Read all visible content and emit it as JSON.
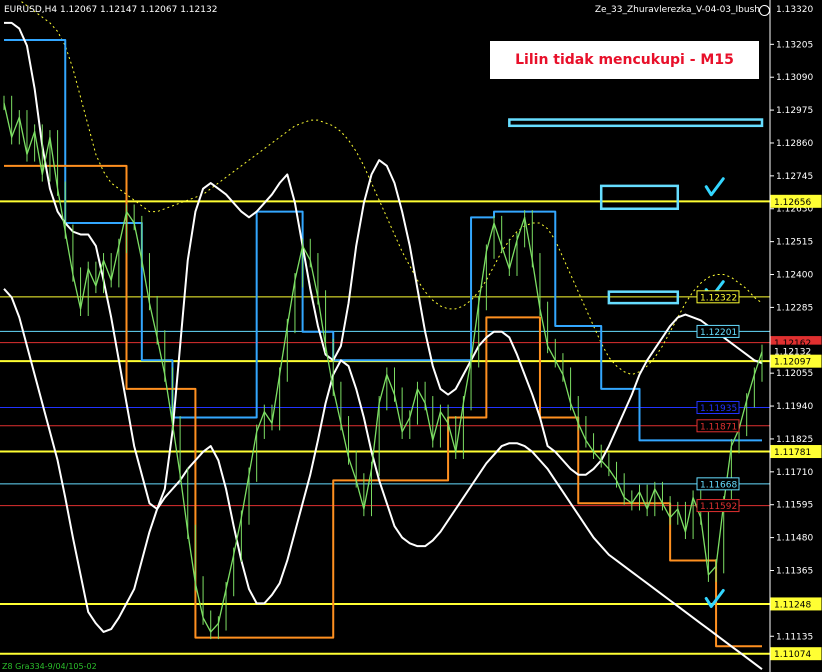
{
  "header": {
    "symbol_line": "EURUSD,H4  1.12067 1.12147 1.12067 1.12132",
    "indicator_name": "Ze_33_Zhuravlerezka_V-04-03_Ibush"
  },
  "annotation": {
    "text": "Lilin tidak mencukupi - M15"
  },
  "footer": {
    "text": "Z8 Gra334-9/04/105-02"
  },
  "colors": {
    "background": "#000000",
    "price": "#7ddf64",
    "envelope": "#ffffff",
    "step_upper": "#33a7ff",
    "step_lower": "#ff9020",
    "level_yellow": "#ffff33",
    "level_cyan": "#66ddff",
    "level_red": "#e03030",
    "level_blue": "#2233ff",
    "checkmark": "#33d6ff"
  },
  "chart_data": {
    "type": "line",
    "symbol": "EURUSD",
    "timeframe": "H4",
    "ohlc_header": {
      "open": 1.12067,
      "high": 1.12147,
      "low": 1.12067,
      "close": 1.12132
    },
    "ylim": [
      1.1101,
      1.1336
    ],
    "y_ticks": [
      "1.13320",
      "1.13205",
      "1.13090",
      "1.12975",
      "1.12860",
      "1.12745",
      "1.12630",
      "1.12515",
      "1.12400",
      "1.12285",
      "1.12170",
      "1.12055",
      "1.11940",
      "1.11825",
      "1.11710",
      "1.11595",
      "1.11480",
      "1.11365",
      "1.11250",
      "1.11135"
    ],
    "y_top_label": "1.13320",
    "price_tags": [
      {
        "text": "1.12656",
        "value": 1.12656,
        "bg": "#ffff33",
        "fg": "#000000"
      },
      {
        "text": "1.12322",
        "value": 1.12322,
        "bg": "#000000",
        "fg": "#ffff33",
        "border": "#ffff33"
      },
      {
        "text": "1.12201",
        "value": 1.12201,
        "bg": "#000000",
        "fg": "#66ddff",
        "border": "#66ddff"
      },
      {
        "text": "1.12162",
        "value": 1.12162,
        "bg": "#e03030",
        "fg": "#000000"
      },
      {
        "text": "1.12132",
        "value": 1.12132,
        "bg": "#000000",
        "fg": "#ffffff"
      },
      {
        "text": "1.12097",
        "value": 1.12097,
        "bg": "#ffff33",
        "fg": "#000000"
      },
      {
        "text": "1.11935",
        "value": 1.11935,
        "bg": "#000000",
        "fg": "#2233ff",
        "border": "#2233ff"
      },
      {
        "text": "1.11871",
        "value": 1.11871,
        "bg": "#000000",
        "fg": "#e03030",
        "border": "#e03030"
      },
      {
        "text": "1.11781",
        "value": 1.11781,
        "bg": "#ffff33",
        "fg": "#000000"
      },
      {
        "text": "1.11668",
        "value": 1.11668,
        "bg": "#000000",
        "fg": "#66ddff",
        "border": "#66ddff"
      },
      {
        "text": "1.11592",
        "value": 1.11592,
        "bg": "#000000",
        "fg": "#e03030",
        "border": "#e03030"
      },
      {
        "text": "1.11248",
        "value": 1.11248,
        "bg": "#ffff33",
        "fg": "#000000"
      },
      {
        "text": "1.11074",
        "value": 1.11074,
        "bg": "#ffff33",
        "fg": "#000000"
      }
    ],
    "levels": [
      {
        "value": 1.12656,
        "color": "#ffff33",
        "width": 2
      },
      {
        "value": 1.12322,
        "color": "#ffff33",
        "width": 1
      },
      {
        "value": 1.12201,
        "color": "#66ddff",
        "width": 1
      },
      {
        "value": 1.12162,
        "color": "#e03030",
        "width": 1
      },
      {
        "value": 1.12097,
        "color": "#ffff33",
        "width": 2
      },
      {
        "value": 1.11935,
        "color": "#2233ff",
        "width": 1
      },
      {
        "value": 1.11871,
        "color": "#e03030",
        "width": 1
      },
      {
        "value": 1.11781,
        "color": "#ffff33",
        "width": 2
      },
      {
        "value": 1.11668,
        "color": "#66ddff",
        "width": 1
      },
      {
        "value": 1.11592,
        "color": "#e03030",
        "width": 1
      },
      {
        "value": 1.11248,
        "color": "#ffff33",
        "width": 2
      },
      {
        "value": 1.11074,
        "color": "#ffff33",
        "width": 2
      }
    ],
    "x_count": 100,
    "series": [
      {
        "role": "price",
        "values": [
          1.13,
          1.1288,
          1.1295,
          1.1282,
          1.129,
          1.1275,
          1.1288,
          1.127,
          1.1255,
          1.124,
          1.1228,
          1.1242,
          1.1236,
          1.1245,
          1.1238,
          1.125,
          1.1262,
          1.1258,
          1.1245,
          1.123,
          1.1218,
          1.1205,
          1.1188,
          1.117,
          1.115,
          1.1132,
          1.112,
          1.1115,
          1.1118,
          1.113,
          1.1142,
          1.1155,
          1.117,
          1.1185,
          1.1192,
          1.1188,
          1.1205,
          1.1222,
          1.1238,
          1.125,
          1.1245,
          1.1232,
          1.1215,
          1.12,
          1.1188,
          1.1176,
          1.1168,
          1.1158,
          1.1172,
          1.1195,
          1.1205,
          1.1198,
          1.1185,
          1.119,
          1.12,
          1.1195,
          1.1182,
          1.1192,
          1.1188,
          1.1178,
          1.1195,
          1.121,
          1.123,
          1.1248,
          1.1258,
          1.125,
          1.1242,
          1.1252,
          1.126,
          1.1245,
          1.1228,
          1.1215,
          1.121,
          1.1205,
          1.1195,
          1.1188,
          1.1182,
          1.1178,
          1.1175,
          1.1172,
          1.1168,
          1.1162,
          1.116,
          1.1164,
          1.1158,
          1.1165,
          1.116,
          1.1155,
          1.1158,
          1.115,
          1.1162,
          1.1155,
          1.1135,
          1.1138,
          1.116,
          1.118,
          1.1186,
          1.1196,
          1.1205,
          1.1213
        ]
      },
      {
        "role": "envelope-upper",
        "values": [
          1.1328,
          1.1328,
          1.1326,
          1.132,
          1.1305,
          1.1285,
          1.127,
          1.1262,
          1.1258,
          1.1255,
          1.1254,
          1.1254,
          1.125,
          1.1238,
          1.1225,
          1.121,
          1.1195,
          1.118,
          1.117,
          1.116,
          1.1158,
          1.1165,
          1.1185,
          1.1215,
          1.1245,
          1.1262,
          1.127,
          1.1272,
          1.127,
          1.1268,
          1.1265,
          1.1262,
          1.126,
          1.1262,
          1.1265,
          1.1268,
          1.1272,
          1.1275,
          1.1265,
          1.125,
          1.1235,
          1.1222,
          1.1212,
          1.121,
          1.1215,
          1.123,
          1.125,
          1.1265,
          1.1275,
          1.128,
          1.1278,
          1.1272,
          1.1262,
          1.125,
          1.1235,
          1.122,
          1.1208,
          1.12,
          1.1198,
          1.12,
          1.1205,
          1.121,
          1.1215,
          1.1218,
          1.122,
          1.122,
          1.1218,
          1.1212,
          1.1205,
          1.1198,
          1.119,
          1.118,
          1.1178,
          1.1175,
          1.1172,
          1.117,
          1.117,
          1.1172,
          1.1175,
          1.118,
          1.1186,
          1.1192,
          1.1198,
          1.1205,
          1.121,
          1.1214,
          1.1218,
          1.1222,
          1.1225,
          1.1226,
          1.1225,
          1.1224,
          1.1222,
          1.122,
          1.1218,
          1.1216,
          1.1214,
          1.1212,
          1.121,
          1.1209
        ]
      },
      {
        "role": "envelope-lower",
        "values": [
          1.1235,
          1.1232,
          1.1225,
          1.1215,
          1.1205,
          1.1195,
          1.1185,
          1.1175,
          1.1162,
          1.1148,
          1.1135,
          1.1122,
          1.1118,
          1.1115,
          1.1116,
          1.112,
          1.1125,
          1.113,
          1.114,
          1.115,
          1.1158,
          1.1162,
          1.1165,
          1.1168,
          1.1172,
          1.1175,
          1.1178,
          1.118,
          1.1175,
          1.1165,
          1.1152,
          1.114,
          1.113,
          1.1125,
          1.1125,
          1.1128,
          1.1132,
          1.114,
          1.115,
          1.116,
          1.117,
          1.1182,
          1.1195,
          1.1205,
          1.121,
          1.1208,
          1.12,
          1.119,
          1.1178,
          1.1168,
          1.116,
          1.1152,
          1.1148,
          1.1146,
          1.1145,
          1.1145,
          1.1147,
          1.115,
          1.1154,
          1.1158,
          1.1162,
          1.1166,
          1.117,
          1.1174,
          1.1177,
          1.118,
          1.1181,
          1.1181,
          1.118,
          1.1178,
          1.1175,
          1.1172,
          1.1168,
          1.1164,
          1.116,
          1.1156,
          1.1152,
          1.1148,
          1.1145,
          1.1142,
          1.114,
          1.1138,
          1.1136,
          1.1134,
          1.1132,
          1.113,
          1.1128,
          1.1126,
          1.1124,
          1.1122,
          1.112,
          1.1118,
          1.1116,
          1.1114,
          1.1112,
          1.111,
          1.1108,
          1.1106,
          1.1104,
          1.1102
        ]
      },
      {
        "role": "step-upper",
        "values": [
          1.1322,
          1.1322,
          1.1322,
          1.1322,
          1.1322,
          1.1322,
          1.1322,
          1.1322,
          1.1258,
          1.1258,
          1.1258,
          1.1258,
          1.1258,
          1.1258,
          1.1258,
          1.1258,
          1.1258,
          1.1258,
          1.121,
          1.121,
          1.121,
          1.121,
          1.119,
          1.119,
          1.119,
          1.119,
          1.119,
          1.119,
          1.119,
          1.119,
          1.119,
          1.119,
          1.119,
          1.1262,
          1.1262,
          1.1262,
          1.1262,
          1.1262,
          1.1262,
          1.122,
          1.122,
          1.122,
          1.122,
          1.121,
          1.121,
          1.121,
          1.121,
          1.121,
          1.121,
          1.121,
          1.121,
          1.121,
          1.121,
          1.121,
          1.121,
          1.121,
          1.121,
          1.121,
          1.121,
          1.121,
          1.121,
          1.126,
          1.126,
          1.126,
          1.1262,
          1.1262,
          1.1262,
          1.1262,
          1.1262,
          1.1262,
          1.1262,
          1.1262,
          1.1222,
          1.1222,
          1.1222,
          1.1222,
          1.1222,
          1.1222,
          1.12,
          1.12,
          1.12,
          1.12,
          1.12,
          1.1182,
          1.1182,
          1.1182,
          1.1182,
          1.1182,
          1.1182,
          1.1182,
          1.1182,
          1.1182,
          1.1182,
          1.1182,
          1.1182,
          1.1182,
          1.1182,
          1.1182,
          1.1182,
          1.1182
        ]
      },
      {
        "role": "step-lower",
        "values": [
          1.1278,
          1.1278,
          1.1278,
          1.1278,
          1.1278,
          1.1278,
          1.1278,
          1.1278,
          1.1278,
          1.1278,
          1.1278,
          1.1278,
          1.1278,
          1.1278,
          1.1278,
          1.1278,
          1.12,
          1.12,
          1.12,
          1.12,
          1.12,
          1.12,
          1.12,
          1.12,
          1.12,
          1.1113,
          1.1113,
          1.1113,
          1.1113,
          1.1113,
          1.1113,
          1.1113,
          1.1113,
          1.1113,
          1.1113,
          1.1113,
          1.1113,
          1.1113,
          1.1113,
          1.1113,
          1.1113,
          1.1113,
          1.1113,
          1.1168,
          1.1168,
          1.1168,
          1.1168,
          1.1168,
          1.1168,
          1.1168,
          1.1168,
          1.1168,
          1.1168,
          1.1168,
          1.1168,
          1.1168,
          1.1168,
          1.1168,
          1.119,
          1.119,
          1.119,
          1.119,
          1.119,
          1.1225,
          1.1225,
          1.1225,
          1.1225,
          1.1225,
          1.1225,
          1.1225,
          1.119,
          1.119,
          1.119,
          1.119,
          1.119,
          1.116,
          1.116,
          1.116,
          1.116,
          1.116,
          1.116,
          1.116,
          1.116,
          1.116,
          1.116,
          1.116,
          1.116,
          1.114,
          1.114,
          1.114,
          1.114,
          1.114,
          1.114,
          1.111,
          1.111,
          1.111,
          1.111,
          1.111,
          1.111,
          1.111
        ]
      },
      {
        "role": "dotted-upper",
        "values": [
          1.1338,
          1.1338,
          1.1336,
          1.1334,
          1.1332,
          1.133,
          1.1328,
          1.1325,
          1.132,
          1.1312,
          1.1302,
          1.1292,
          1.1282,
          1.1276,
          1.1272,
          1.127,
          1.1268,
          1.1266,
          1.1264,
          1.1262,
          1.1262,
          1.1263,
          1.1264,
          1.1265,
          1.1266,
          1.1267,
          1.1268,
          1.127,
          1.1272,
          1.1274,
          1.1276,
          1.1278,
          1.128,
          1.1282,
          1.1284,
          1.1286,
          1.1288,
          1.129,
          1.1292,
          1.1293,
          1.1294,
          1.1294,
          1.1293,
          1.1292,
          1.129,
          1.1287,
          1.1283,
          1.1278,
          1.1272,
          1.1266,
          1.126,
          1.1254,
          1.1248,
          1.1243,
          1.1238,
          1.1234,
          1.1231,
          1.1229,
          1.1228,
          1.1228,
          1.1229,
          1.1231,
          1.1234,
          1.1238,
          1.1243,
          1.1248,
          1.1252,
          1.1255,
          1.1257,
          1.1258,
          1.1258,
          1.1256,
          1.1252,
          1.1246,
          1.124,
          1.1234,
          1.1228,
          1.1222,
          1.1216,
          1.1211,
          1.1208,
          1.1206,
          1.1205,
          1.1206,
          1.1208,
          1.1211,
          1.1215,
          1.122,
          1.1225,
          1.123,
          1.1234,
          1.1237,
          1.1239,
          1.124,
          1.124,
          1.1239,
          1.1237,
          1.1235,
          1.1232,
          1.123
        ]
      }
    ],
    "markers": [
      {
        "shape": "rect-outline",
        "color": "#66ddff",
        "x0": 66,
        "x1": 99,
        "y0": 1.12942,
        "y1": 1.1292
      },
      {
        "shape": "rect-outline",
        "color": "#66ddff",
        "x0": 78,
        "x1": 88,
        "y0": 1.1271,
        "y1": 1.1263
      },
      {
        "shape": "rect-outline",
        "color": "#66ddff",
        "x0": 79,
        "x1": 88,
        "y0": 1.1234,
        "y1": 1.123
      },
      {
        "shape": "check",
        "color": "#33d6ff",
        "x": 92.5,
        "y": 1.127
      },
      {
        "shape": "check",
        "color": "#33d6ff",
        "x": 92.5,
        "y": 1.1234
      },
      {
        "shape": "check",
        "color": "#33d6ff",
        "x": 92.5,
        "y": 1.1126
      }
    ]
  }
}
